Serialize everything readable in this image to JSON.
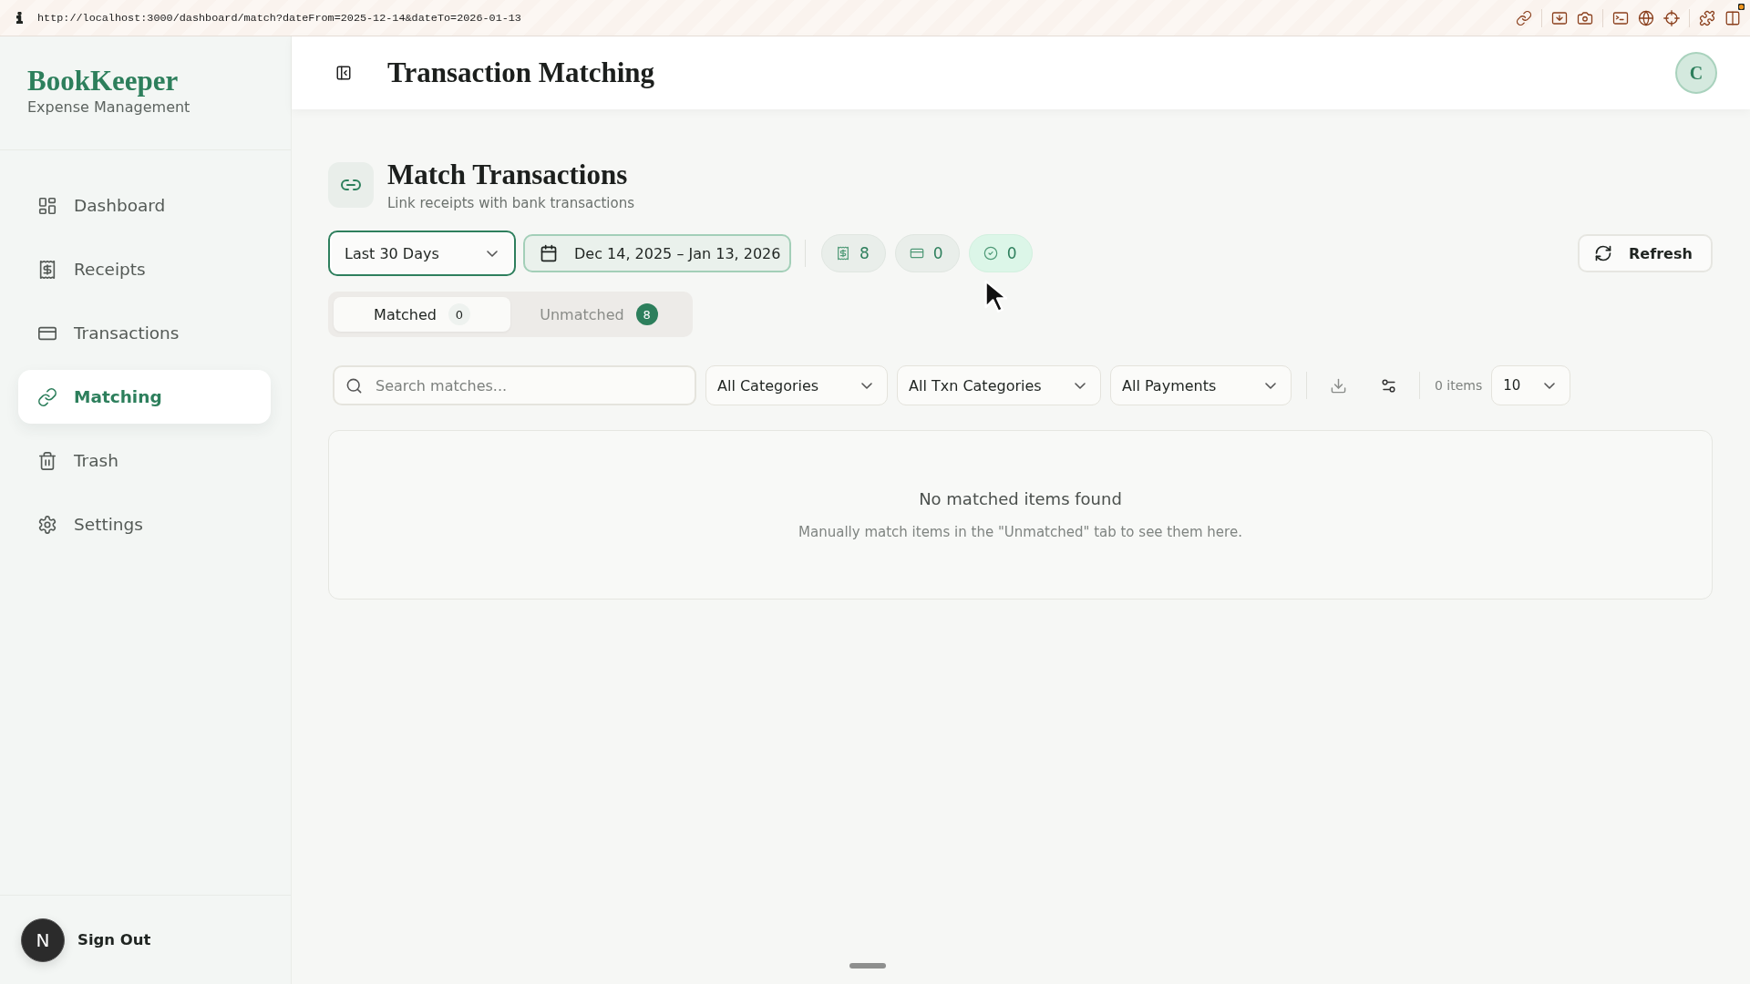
{
  "browser": {
    "url": "http://localhost:3000/dashboard/match?dateFrom=2025-12-14&dateTo=2026-01-13"
  },
  "sidebar": {
    "brand": {
      "name": "BookKeeper",
      "tagline": "Expense Management"
    },
    "items": [
      {
        "kind": "dashboard",
        "label": "Dashboard",
        "selected": false
      },
      {
        "kind": "receipts",
        "label": "Receipts",
        "selected": false
      },
      {
        "kind": "transactions",
        "label": "Transactions",
        "selected": false
      },
      {
        "kind": "matching",
        "label": "Matching",
        "selected": true
      },
      {
        "kind": "trash",
        "label": "Trash",
        "selected": false
      },
      {
        "kind": "settings",
        "label": "Settings",
        "selected": false
      }
    ],
    "user": {
      "initial": "N",
      "action": "Sign Out"
    }
  },
  "header": {
    "title": "Transaction Matching",
    "avatar_initial": "C"
  },
  "page": {
    "title": "Match Transactions",
    "subtitle": "Link receipts with bank transactions"
  },
  "toolbar": {
    "range": {
      "value": "Last 30 Days",
      "focused": true
    },
    "date_range": "Dec 14, 2025 – Jan 13, 2026",
    "counters": [
      {
        "kind": "receipts",
        "value": "8",
        "hovered": false
      },
      {
        "kind": "transactions",
        "value": "0",
        "hovered": false
      },
      {
        "kind": "matched",
        "value": "0",
        "hovered": true
      }
    ],
    "refresh": "Refresh"
  },
  "tabs": [
    {
      "label": "Matched",
      "count": "0",
      "selected": true,
      "badge_filled": false
    },
    {
      "label": "Unmatched",
      "count": "8",
      "selected": false,
      "badge_filled": true
    }
  ],
  "filters": {
    "search": {
      "placeholder": "Search matches..."
    },
    "selects": [
      "All Categories",
      "All Txn Categories",
      "All Payments"
    ],
    "item_count": "0 items",
    "page_size": "10"
  },
  "empty_state": {
    "title": "No matched items found",
    "message": "Manually match items in the \"Unmatched\" tab to see them here."
  }
}
